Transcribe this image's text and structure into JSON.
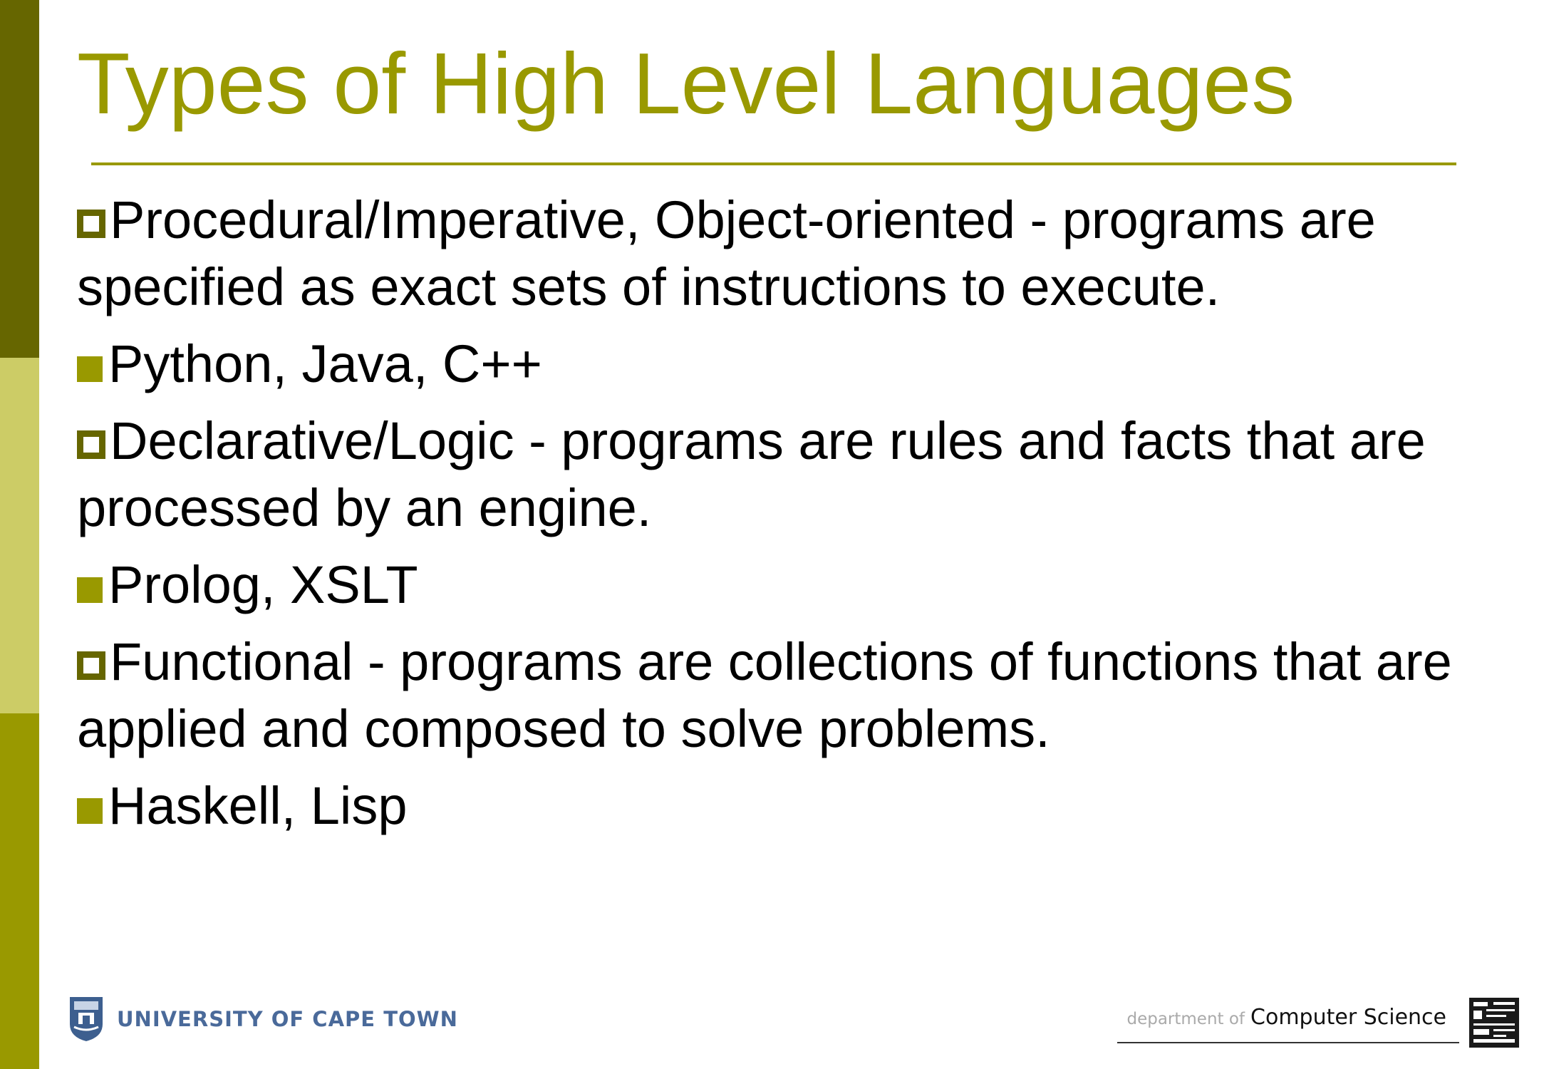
{
  "slide": {
    "title": "Types of High Level Languages",
    "items": [
      {
        "level": 1,
        "text": "Procedural/Imperative, Object-oriented - programs are specified as exact sets of instructions to execute."
      },
      {
        "level": 2,
        "text": "Python, Java, C++"
      },
      {
        "level": 1,
        "text": "Declarative/Logic - programs are rules and facts that are processed by an engine."
      },
      {
        "level": 2,
        "text": "Prolog, XSLT"
      },
      {
        "level": 1,
        "text": "Functional - programs are collections of functions that are applied and composed to solve problems."
      },
      {
        "level": 2,
        "text": "Haskell, Lisp"
      }
    ]
  },
  "footer": {
    "university": "UNIVERSITY OF CAPE TOWN",
    "dept_prefix": "department of",
    "dept_name": "Computer Science",
    "crest_icon": "university-crest-icon",
    "dept_logo_icon": "department-logo-icon"
  },
  "colors": {
    "title": "#999900",
    "bar_top": "#666600",
    "bar_middle": "#cccc66",
    "bar_bottom": "#999900",
    "hollow_bullet": "#666600",
    "solid_bullet": "#999900",
    "university_text": "#4a6a9a"
  }
}
